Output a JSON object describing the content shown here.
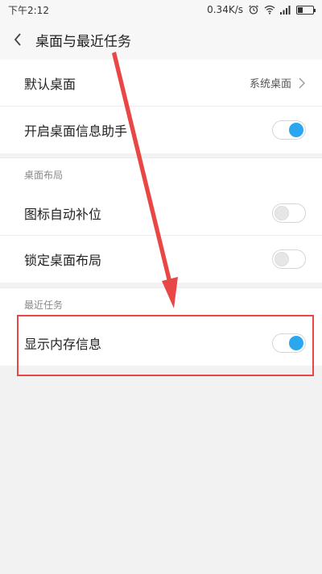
{
  "status_bar": {
    "time": "下午2:12",
    "network_speed": "0.34K/s",
    "icons": [
      "alarm-icon",
      "wifi-icon",
      "signal-icon",
      "battery-icon"
    ],
    "battery_level": 0.35
  },
  "header": {
    "back_icon": "chevron-left-icon",
    "title": "桌面与最近任务"
  },
  "group1": {
    "items": [
      {
        "label": "默认桌面",
        "value": "系统桌面",
        "type": "link"
      },
      {
        "label": "开启桌面信息助手",
        "type": "toggle",
        "on": true
      }
    ]
  },
  "group2": {
    "header": "桌面布局",
    "items": [
      {
        "label": "图标自动补位",
        "type": "toggle",
        "on": false
      },
      {
        "label": "锁定桌面布局",
        "type": "toggle",
        "on": false
      }
    ]
  },
  "group3": {
    "header": "最近任务",
    "items": [
      {
        "label": "显示内存信息",
        "type": "toggle",
        "on": true
      }
    ]
  },
  "colors": {
    "accent": "#2aa7ef",
    "annotation": "#e94646"
  }
}
